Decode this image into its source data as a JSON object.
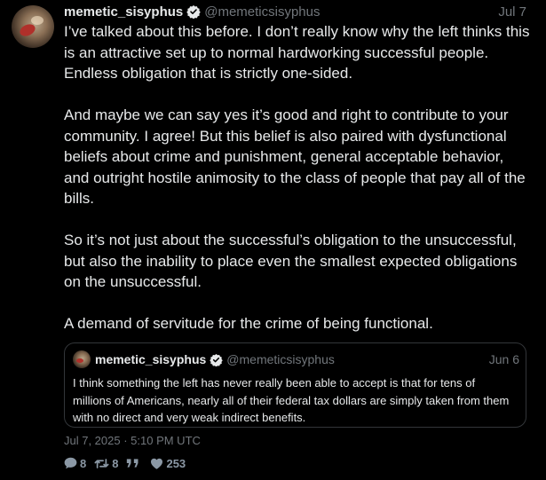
{
  "post": {
    "author": {
      "display_name": "memetic_sisyphus",
      "handle": "@memeticsisyphus",
      "verified_icon": "verified-badge-icon"
    },
    "date": "Jul 7",
    "paragraphs": [
      "I’ve talked about this before. I don’t really know why the left thinks this is an attractive set up to normal hardworking successful people. Endless obligation that is strictly one-sided.",
      "And maybe we can say yes it’s good and right to contribute to your community. I agree! But this belief is also paired with dysfunctional beliefs about crime and punishment, general acceptable behavior, and outright hostile animosity to the class of people that pay all of the bills.",
      "So it’s not just about the successful’s obligation to the unsuccessful, but also the inability to place even the smallest expected obligations on the unsuccessful.",
      "A demand of servitude for the crime of being functional."
    ],
    "timestamp": "Jul 7, 2025 · 5:10 PM UTC"
  },
  "quote": {
    "author": {
      "display_name": "memetic_sisyphus",
      "handle": "@memeticsisyphus"
    },
    "date": "Jun 6",
    "text": "I think something the left has never really been able to accept is that for tens of millions of Americans, nearly all of their federal tax dollars are simply taken from them with no direct and very weak indirect benefits."
  },
  "actions": {
    "replies": "8",
    "retweets": "8",
    "quotes": "",
    "likes": "253",
    "icons": [
      "reply-icon",
      "retweet-icon",
      "quote-icon",
      "like-icon"
    ]
  },
  "colors": {
    "background": "#000000",
    "text": "#e7e9ea",
    "muted": "#71767b",
    "action": "#8b98a5",
    "verified": "#e7e9ea",
    "border": "#333639"
  }
}
